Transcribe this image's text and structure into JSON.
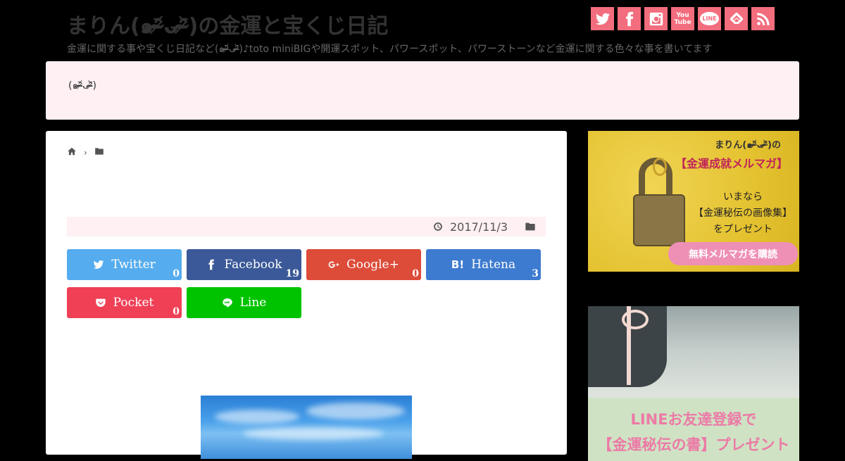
{
  "site": {
    "title": "まりん(๑ᵔ̴̶̷᷄ᴗᵔ̴̶̷᷅)の金運と宝くじ日記",
    "description": "金運に関する事や宝くじ日記など(๑ᵔ̴̶̷᷄ᴗᵔ̴̶̷᷅)♪toto miniBIGや開運スポット、パワースポット、パワーストーンなど金運に関する色々な事を書いてます"
  },
  "social": [
    {
      "name": "twitter-icon",
      "label": ""
    },
    {
      "name": "facebook-icon",
      "label": ""
    },
    {
      "name": "instagram-icon",
      "label": ""
    },
    {
      "name": "youtube-icon",
      "label": "You Tube"
    },
    {
      "name": "line-icon",
      "label": "LINE"
    },
    {
      "name": "feedly-icon",
      "label": ""
    },
    {
      "name": "rss-icon",
      "label": ""
    }
  ],
  "notice": {
    "text": "(๑ᵔ̴̶̷᷄ᴗᵔ̴̶̷᷅)"
  },
  "breadcrumb": {
    "home": "home-icon",
    "category": "folder-icon"
  },
  "post": {
    "date": "2017/11/3"
  },
  "share_buttons": [
    {
      "label": "Twitter",
      "count": "0",
      "color": "#55acee"
    },
    {
      "label": "Facebook",
      "count": "19",
      "color": "#3b5998"
    },
    {
      "label": "Google+",
      "count": "0",
      "color": "#dd4b39"
    },
    {
      "label": "Hatena",
      "count": "3",
      "color": "#3d7bd0"
    },
    {
      "label": "Pocket",
      "count": "0",
      "color": "#ef4056"
    },
    {
      "label": "Line",
      "count": "",
      "color": "#00c300"
    }
  ],
  "sidebar": {
    "banner1": {
      "title": "まりん(๑ᵔ̴̶̷᷄ᴗᵔ̴̶̷᷅)の",
      "subtitle": "【金運成就メルマガ】",
      "line1": "いまなら",
      "line2": "【金運秘伝の画像集】",
      "line3": "をプレゼント",
      "button": "無料メルマガを購読"
    },
    "banner2": {
      "title": "LINEお友達登録で",
      "subtitle": "【金運秘伝の書】プレゼント"
    }
  },
  "colors": {
    "accent": "#f26d7d",
    "notice_bg": "#fef0f3",
    "page_bg": "#000000"
  }
}
